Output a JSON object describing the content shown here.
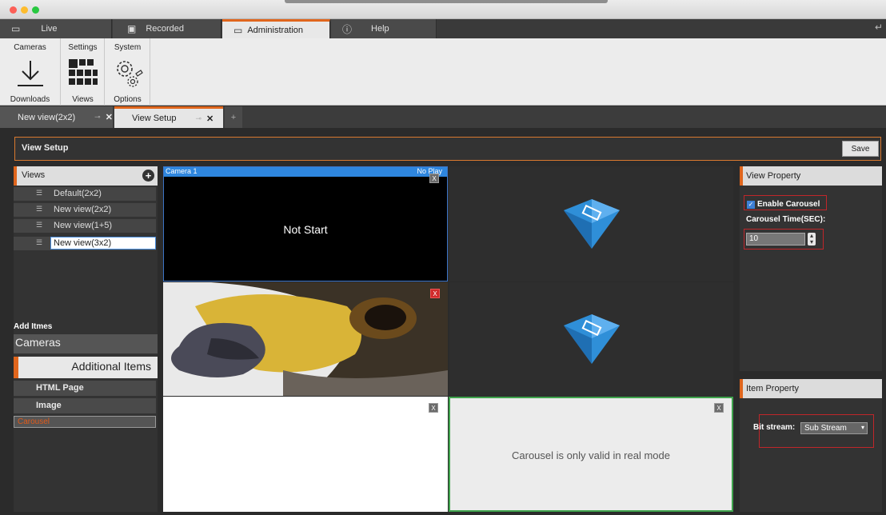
{
  "main_tabs": [
    {
      "label": "Live",
      "icon": "monitor-icon"
    },
    {
      "label": "Recorded",
      "icon": "play-icon"
    },
    {
      "label": "Administration",
      "icon": "folder-icon"
    },
    {
      "label": "Help",
      "icon": "help-icon"
    }
  ],
  "ribbon": {
    "groups": [
      {
        "label": "Cameras",
        "button": "Downloads",
        "icon": "download-icon"
      },
      {
        "label": "Settings",
        "button": "Views",
        "icon": "grid-icon"
      },
      {
        "label": "System",
        "button": "Options",
        "icon": "gears-icon"
      }
    ]
  },
  "doc_tabs": [
    {
      "label": "New view(2x2)"
    },
    {
      "label": "View Setup"
    }
  ],
  "view_setup": {
    "title": "View Setup",
    "save_label": "Save"
  },
  "views_panel": {
    "title": "Views",
    "items": [
      "Default(2x2)",
      "New view(2x2)",
      "New view(1+5)",
      "New view(3x2)"
    ],
    "add_items_label": "Add Itmes",
    "cameras_label": "Cameras",
    "additional_label": "Additional Items",
    "sub_items": [
      "HTML Page",
      "Image",
      "Carousel"
    ]
  },
  "grid": {
    "camera_title": "Camera 1",
    "camera_status": "No Play",
    "not_start": "Not Start",
    "carousel_msg": "Carousel is only valid in real mode",
    "close_glyph": "X"
  },
  "view_property": {
    "title": "View Property",
    "enable_carousel": "Enable Carousel",
    "carousel_time_label": "Carousel Time(SEC):",
    "carousel_time_value": "10"
  },
  "item_property": {
    "title": "Item Property",
    "bitstream_label": "Bit stream:",
    "bitstream_value": "Sub Stream"
  },
  "colors": {
    "accent": "#e0661d",
    "selection": "#3d7fd6",
    "highlight_box": "#c0262a"
  }
}
